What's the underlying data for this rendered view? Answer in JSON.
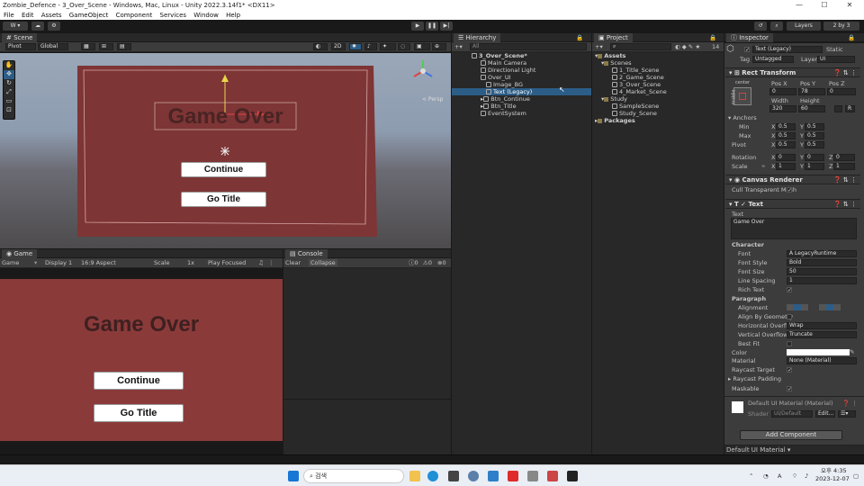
{
  "window": {
    "title": "Zombie_Defence - 3_Over_Scene - Windows, Mac, Linux - Unity 2022.3.14f1* <DX11>"
  },
  "menu": [
    "File",
    "Edit",
    "Assets",
    "GameObject",
    "Component",
    "Services",
    "Window",
    "Help"
  ],
  "toolbar": {
    "account": "W ▾",
    "layers": "Layers",
    "layout": "2 by 3"
  },
  "scene": {
    "tab": "Scene",
    "pivot": "Pivot",
    "global": "Global",
    "mode": "2D",
    "persp": "< Persp",
    "ui_title": "Game Over",
    "btn_continue": "Continue",
    "btn_title": "Go Title"
  },
  "game": {
    "tab": "Game",
    "mode": "Game",
    "display": "Display 1",
    "aspect": "16:9 Aspect",
    "scale_label": "Scale",
    "scale": "1x",
    "play": "Play Focused",
    "title": "Game Over",
    "btn_continue": "Continue",
    "btn_title": "Go Title"
  },
  "console": {
    "tab": "Console",
    "clear": "Clear",
    "collapse": "Collapse",
    "c0": "0",
    "c1": "0",
    "c2": "0"
  },
  "hierarchy": {
    "tab": "Hierarchy",
    "search": "All",
    "items": [
      "3_Over_Scene*",
      "Main Camera",
      "Directional Light",
      "Over_UI",
      "Image_BG",
      "Text (Legacy)",
      "Btn_Continue",
      "Btn_Title",
      "EventSystem"
    ]
  },
  "project": {
    "tab": "Project",
    "count": "14",
    "items": [
      "Assets",
      "Scenes",
      "1_Title_Scene",
      "2_Game_Scene",
      "3_Over_Scene",
      "4_Market_Scene",
      "Study",
      "SampleScene",
      "Study_Scene",
      "Packages"
    ]
  },
  "inspector": {
    "tab": "Inspector",
    "name": "Text (Legacy)",
    "static": "Static",
    "tag_label": "Tag",
    "tag": "Untagged",
    "layer_label": "Layer",
    "layer": "UI",
    "rect": "Rect Transform",
    "center": "center",
    "middle": "middle",
    "posx_l": "Pos X",
    "posy_l": "Pos Y",
    "posz_l": "Pos Z",
    "posx": "0",
    "posy": "78",
    "posz": "0",
    "width_l": "Width",
    "height_l": "Height",
    "width": "320",
    "height": "60",
    "anchors": "Anchors",
    "min": "Min",
    "max": "Max",
    "pivot": "Pivot",
    "ax": "X",
    "ay": "Y",
    "az": "Z",
    "half": "0.5",
    "rotation": "Rotation",
    "scale": "Scale",
    "zero": "0",
    "one": "1",
    "canvas": "Canvas Renderer",
    "cull": "Cull Transparent Mesh",
    "text_comp": "Text",
    "text_l": "Text",
    "text": "Game Over",
    "character": "Character",
    "font_l": "Font",
    "font": "LegacyRuntime",
    "style_l": "Font Style",
    "style": "Bold",
    "size_l": "Font Size",
    "size": "50",
    "spacing_l": "Line Spacing",
    "spacing": "1",
    "rich_l": "Rich Text",
    "paragraph": "Paragraph",
    "align_l": "Alignment",
    "geom_l": "Align By Geometry",
    "hover_l": "Horizontal Overflow",
    "hover": "Wrap",
    "vover_l": "Vertical Overflow",
    "vover": "Truncate",
    "bestfit_l": "Best Fit",
    "color_l": "Color",
    "mat_l": "Material",
    "mat": "None (Material)",
    "raycast_l": "Raycast Target",
    "pad_l": "Raycast Padding",
    "mask_l": "Maskable",
    "matname": "Default UI Material (Material)",
    "shader_l": "Shader",
    "shader": "UI/Default",
    "edit": "Edit...",
    "add": "Add Component",
    "footer": "Default UI Material ▾"
  },
  "taskbar": {
    "search": "검색",
    "ampm": "오후 4:35",
    "date": "2023-12-07"
  },
  "colors": {
    "game_bg": "#8b3a3a",
    "accent": "#2c5d87",
    "canvas": "#7e3535"
  }
}
